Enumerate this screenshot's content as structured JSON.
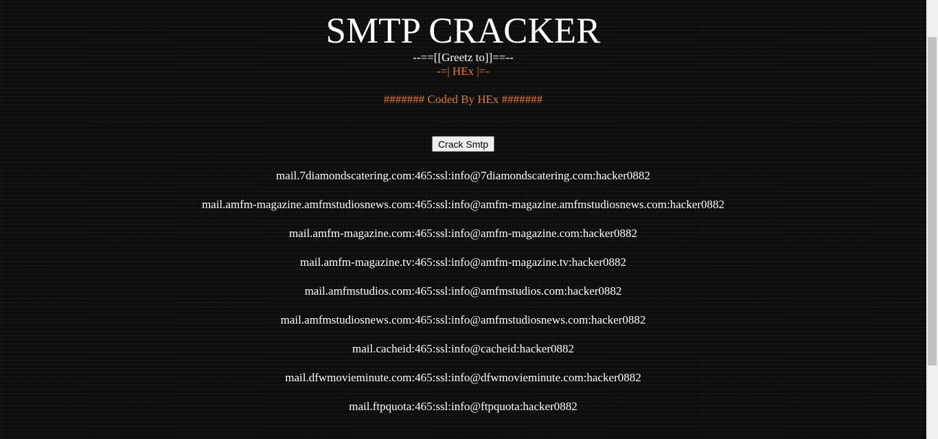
{
  "header": {
    "title": "SMTP CRACKER",
    "greetz": "--==[[Greetz to]]==--",
    "hex": "-=| HEx |=-",
    "coded_by": "####### Coded By HEx #######"
  },
  "form": {
    "crack_button_label": "Crack Smtp"
  },
  "results": [
    "mail.7diamondscatering.com:465:ssl:info@7diamondscatering.com:hacker0882",
    "mail.amfm-magazine.amfmstudiosnews.com:465:ssl:info@amfm-magazine.amfmstudiosnews.com:hacker0882",
    "mail.amfm-magazine.com:465:ssl:info@amfm-magazine.com:hacker0882",
    "mail.amfm-magazine.tv:465:ssl:info@amfm-magazine.tv:hacker0882",
    "mail.amfmstudios.com:465:ssl:info@amfmstudios.com:hacker0882",
    "mail.amfmstudiosnews.com:465:ssl:info@amfmstudiosnews.com:hacker0882",
    "mail.cacheid:465:ssl:info@cacheid:hacker0882",
    "mail.dfwmovieminute.com:465:ssl:info@dfwmovieminute.com:hacker0882",
    "mail.ftpquota:465:ssl:info@ftpquota:hacker0882"
  ],
  "colors": {
    "background": "#0c0c0c",
    "text": "#ffffff",
    "accent": "#e07b2a"
  }
}
